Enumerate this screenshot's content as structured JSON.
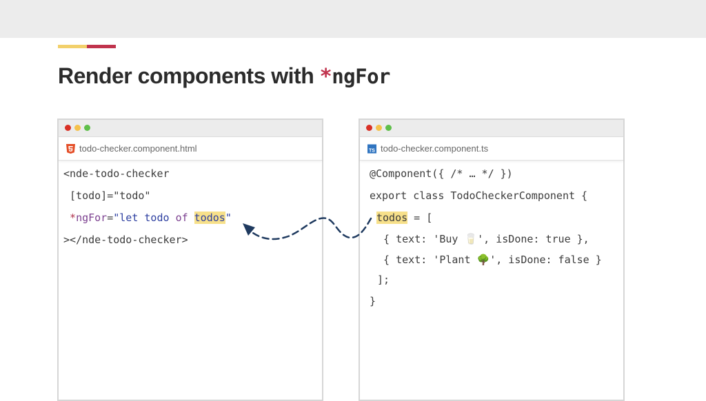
{
  "slide": {
    "title_prefix": "Render components with ",
    "title_star": "*",
    "title_keyword": "ngFor"
  },
  "left_panel": {
    "filename": "todo-checker.component.html",
    "file_icon": "html5-icon",
    "lines": {
      "l1": "<nde-todo-checker",
      "l2": " [todo]=\"todo\"",
      "l3_star": " *",
      "l3_attr": "ngFor",
      "l3_eq": "=",
      "l3_q1": "\"",
      "l3_let": "let todo ",
      "l3_of": "of",
      "l3_sp": " ",
      "l3_todos": "todos",
      "l3_q2": "\"",
      "l4": "></nde-todo-checker>"
    }
  },
  "right_panel": {
    "filename": "todo-checker.component.ts",
    "file_icon": "typescript-icon",
    "file_icon_text": "TS",
    "lines": {
      "l1": "@Component({ /* … */ })",
      "l2": "export class TodoCheckerComponent {",
      "l3_todos": "todos",
      "l3_rest": " = [",
      "l4": "  { text: 'Buy 🥛', isDone: true },",
      "l5": "  { text: 'Plant 🌳', isDone: false }",
      "l6": " ];",
      "l7": "}"
    }
  },
  "colors": {
    "accent_yellow": "#f2d06b",
    "accent_red": "#c0334d",
    "highlight": "#f7e08a",
    "arrow": "#1f3a5f"
  }
}
